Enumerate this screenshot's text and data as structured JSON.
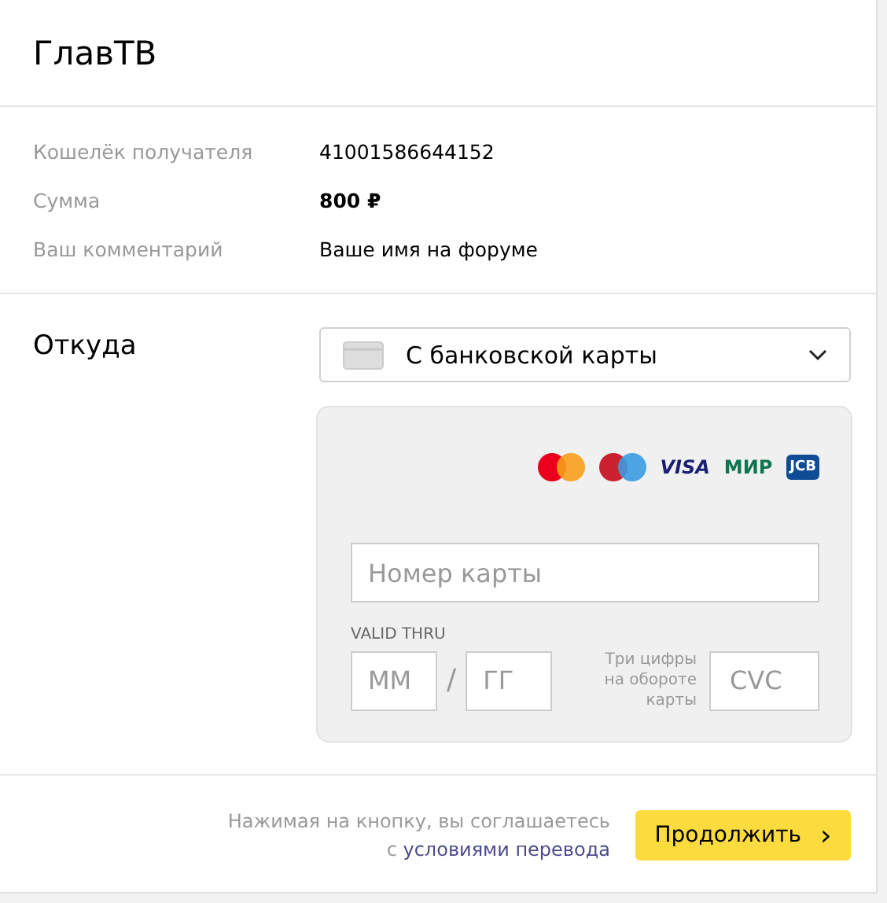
{
  "title": "ГлавТВ",
  "details": [
    {
      "label": "Кошелёк получателя",
      "value": "41001586644152",
      "bold": false
    },
    {
      "label": "Сумма",
      "value": "800 ₽",
      "bold": true
    },
    {
      "label": "Ваш комментарий",
      "value": "Ваше имя на форуме",
      "bold": false
    }
  ],
  "source": {
    "label": "Откуда",
    "select": "С банковской карты"
  },
  "card": {
    "logos": [
      {
        "kind": "mastercard"
      },
      {
        "kind": "maestro"
      },
      {
        "kind": "visa",
        "text": "VISA"
      },
      {
        "kind": "mir",
        "text": "МИР"
      },
      {
        "kind": "jcb",
        "text": "JCB"
      }
    ],
    "number_placeholder": "Номер карты",
    "valid_label": "VALID THRU",
    "month_placeholder": "ММ",
    "separator": "/",
    "year_placeholder": "ГГ",
    "cvc_hint": "Три цифры на обороте карты",
    "cvc_placeholder": "CVC"
  },
  "footer": {
    "agreement": "Нажимая на кнопку, вы соглашаетесь\nс",
    "link": "условиями перевода",
    "button": "Продолжить",
    "button_icon": "›"
  }
}
